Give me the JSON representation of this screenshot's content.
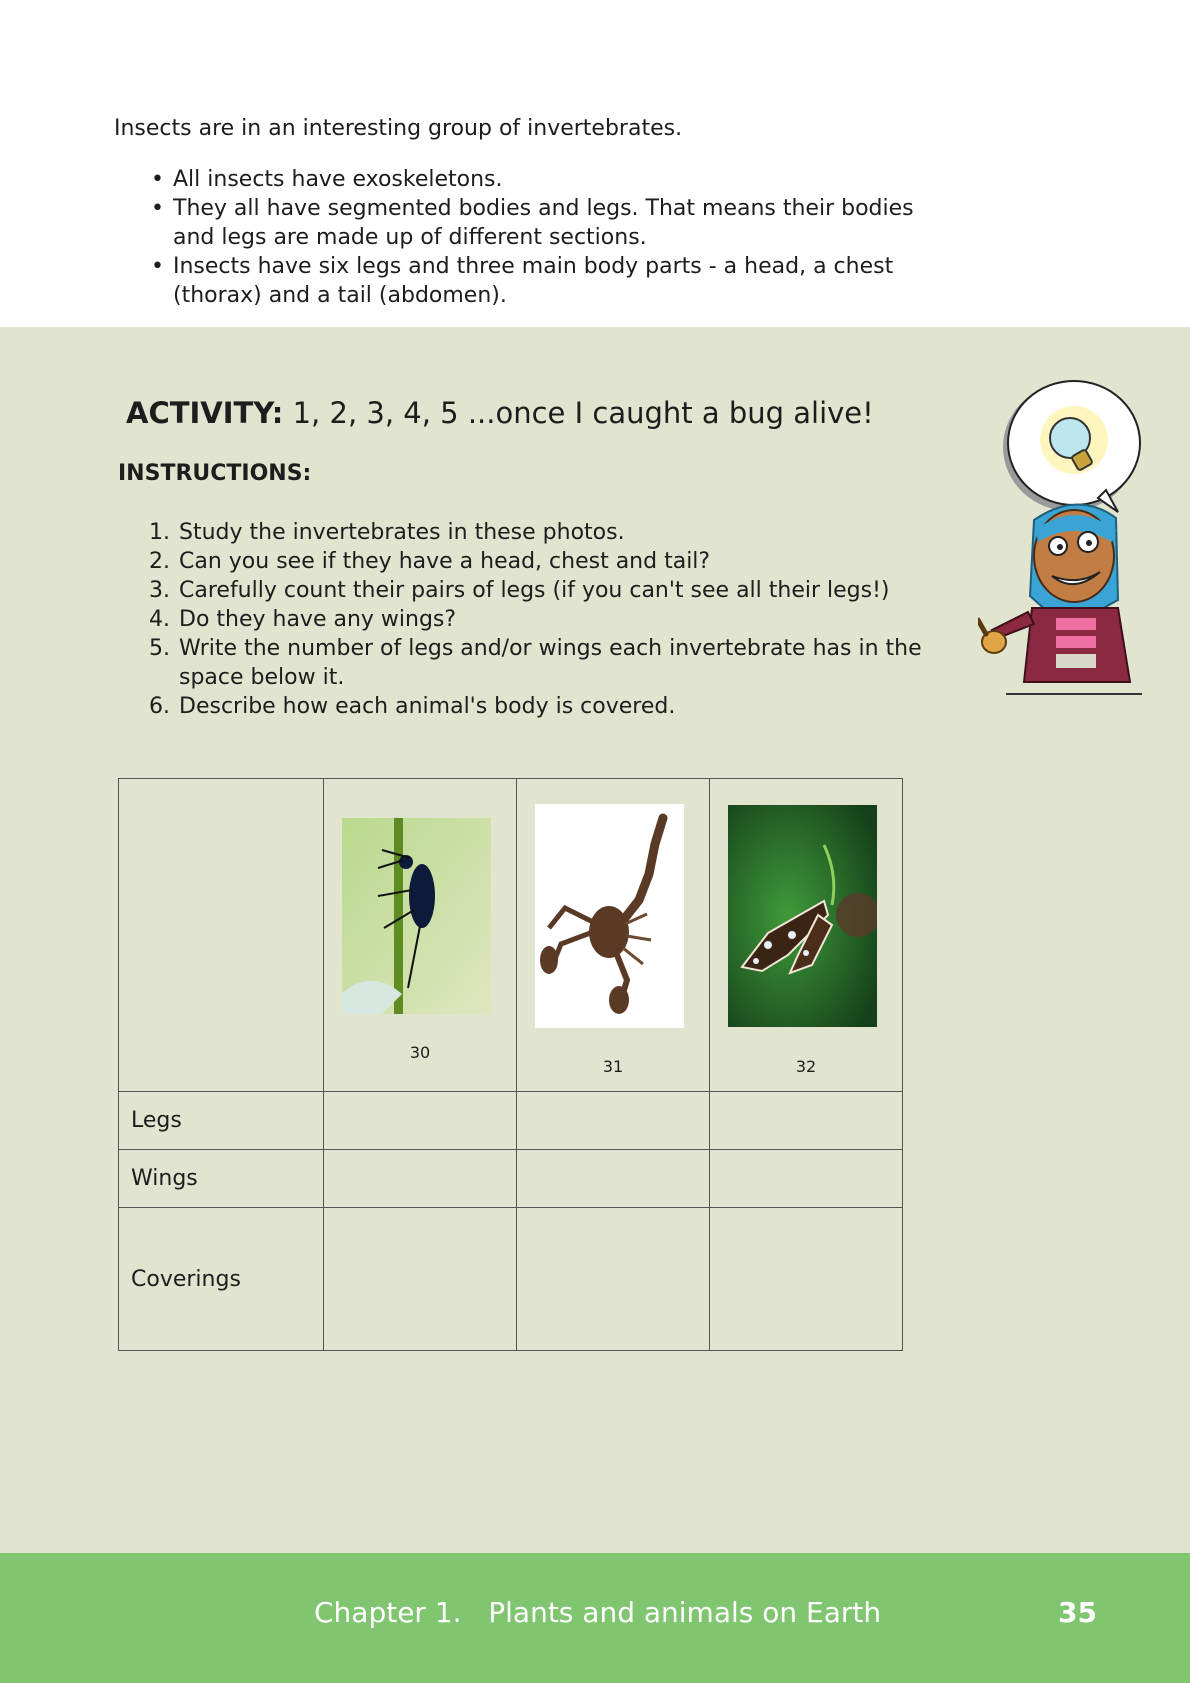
{
  "intro": {
    "lead": "Insects are in an interesting group of invertebrates.",
    "bullets": [
      "All insects have exoskeletons.",
      "They all have segmented bodies and legs. That means their bodies and legs are made up of different sections.",
      "Insects have six legs and three main body parts - a head, a chest (thorax) and a tail (abdomen)."
    ]
  },
  "activity": {
    "label": "ACTIVITY:",
    "title": "1, 2, 3, 4, 5 ...once I caught a bug alive!",
    "instructions_heading": "INSTRUCTIONS:",
    "steps": [
      "Study the invertebrates in these photos.",
      "Can you see if they have a head, chest and tail?",
      "Carefully count their pairs of legs (if you can't see all their legs!)",
      "Do they have any wings?",
      "Write the number of legs and/or wings each invertebrate has in the space below it.",
      "Describe how each animal's body is covered."
    ]
  },
  "table": {
    "captions": [
      "30",
      "31",
      "32"
    ],
    "rows": [
      "Legs",
      "Wings",
      "Coverings"
    ]
  },
  "footer": {
    "chapter": "Chapter 1.   Plants and animals on Earth",
    "page": "35"
  },
  "colors": {
    "activity_bg": "#e1e5d0",
    "footer_bg": "#80c570"
  }
}
